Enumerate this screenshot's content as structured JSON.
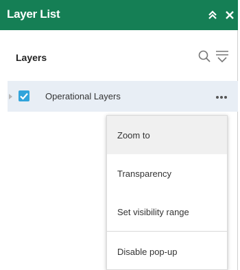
{
  "panel": {
    "title": "Layer List",
    "collapse_icon": "double-chevron-up-icon",
    "close_icon": "close-icon"
  },
  "section": {
    "title": "Layers",
    "search_icon": "search-icon",
    "filter_icon": "filter-icon"
  },
  "layers": [
    {
      "label": "Operational Layers",
      "checked": true,
      "expanded": false
    }
  ],
  "menu": {
    "items": [
      {
        "label": "Zoom to"
      },
      {
        "label": "Transparency"
      },
      {
        "label": "Set visibility range"
      },
      {
        "label": "Disable pop-up"
      }
    ]
  },
  "colors": {
    "header": "#157f55",
    "checkbox": "#31a4db",
    "row_highlight": "#e8eef5"
  }
}
